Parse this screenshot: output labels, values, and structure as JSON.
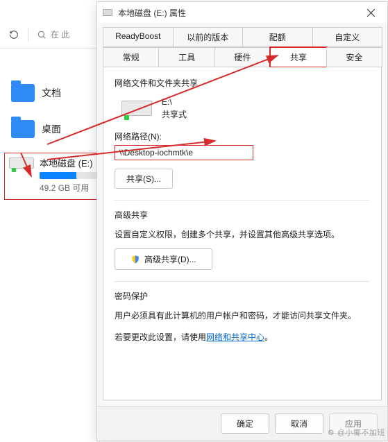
{
  "explorer": {
    "search_placeholder": "在 此",
    "items": [
      {
        "label": "文档"
      },
      {
        "label": "桌面"
      }
    ],
    "drive": {
      "name": "本地磁盘 (E:)",
      "subtext": "49.2 GB 可用"
    }
  },
  "dialog": {
    "title": "本地磁盘 (E:) 属性",
    "tabs_row1": [
      "ReadyBoost",
      "以前的版本",
      "配额",
      "自定义"
    ],
    "tabs_row2": [
      "常规",
      "工具",
      "硬件",
      "共享",
      "安全"
    ],
    "active_tab": "共享",
    "share": {
      "section_title": "网络文件和文件夹共享",
      "drive_letter": "E:\\",
      "status": "共享式",
      "path_label": "网络路径(N):",
      "path_value": "\\\\Desktop-iochmtk\\e",
      "share_btn": "共享(S)..."
    },
    "advanced": {
      "title": "高级共享",
      "desc": "设置自定义权限，创建多个共享，并设置其他高级共享选项。",
      "btn": "高级共享(D)..."
    },
    "password": {
      "title": "密码保护",
      "line1": "用户必须具有此计算机的用户帐户和密码，才能访问共享文件夹。",
      "line2a": "若要更改此设置，请使用",
      "link": "网络和共享中心",
      "line2b": "。"
    },
    "buttons": {
      "ok": "确定",
      "cancel": "取消",
      "apply": "应用"
    }
  },
  "watermark": "⚙ @小椰不加班"
}
